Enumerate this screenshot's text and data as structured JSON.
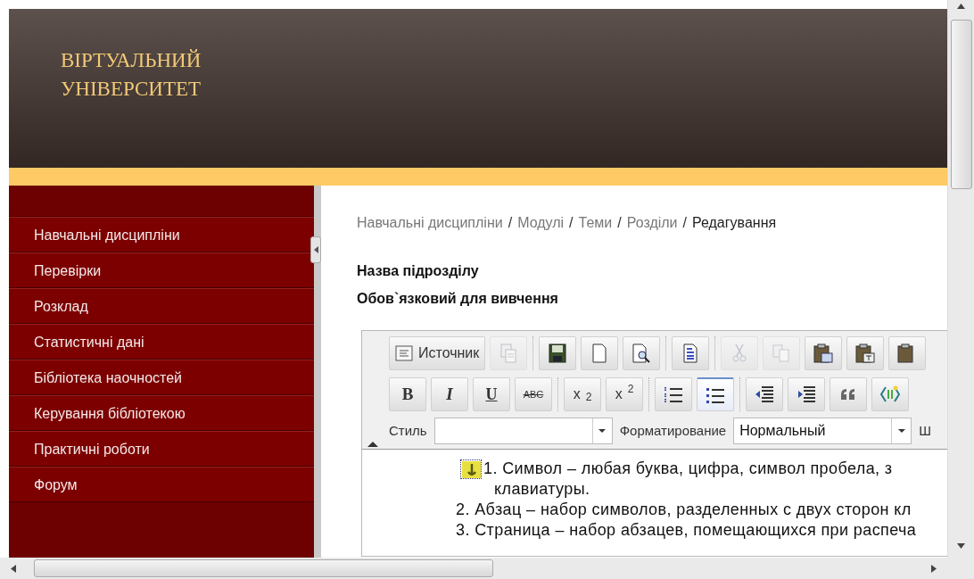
{
  "header": {
    "title_lines": [
      "ВІРТУАЛЬНИЙ",
      "УНІВЕРСИТЕТ"
    ]
  },
  "sidebar": {
    "items": [
      {
        "label": "Навчальні дисципліни"
      },
      {
        "label": "Перевірки"
      },
      {
        "label": "Розклад"
      },
      {
        "label": "Статистичні дані"
      },
      {
        "label": "Бібліотека наочностей"
      },
      {
        "label": "Керування бібліотекою"
      },
      {
        "label": "Практичні роботи"
      },
      {
        "label": "Форум"
      }
    ]
  },
  "breadcrumb": [
    {
      "label": "Навчальні дисципліни",
      "current": false,
      "separator": "/"
    },
    {
      "label": "Модулі",
      "current": false,
      "separator": "/"
    },
    {
      "label": "Теми",
      "current": false,
      "separator": "/"
    },
    {
      "label": "Розділи",
      "current": false,
      "separator": "/"
    },
    {
      "label": "Редагування",
      "current": true
    }
  ],
  "fields": [
    "Назва підрозділу",
    "Обов`язковий для вивчення"
  ],
  "editor": {
    "toolbar_rows": [
      [
        [
          {
            "kind": "source",
            "label": "Источник",
            "disabled": false,
            "active": false
          },
          {
            "kind": "paste-template",
            "disabled": true,
            "active": false
          }
        ],
        [
          {
            "kind": "save",
            "disabled": false,
            "active": false
          },
          {
            "kind": "new-page",
            "disabled": false,
            "active": false
          },
          {
            "kind": "preview",
            "disabled": false,
            "active": false
          }
        ],
        [
          {
            "kind": "templates",
            "disabled": false,
            "active": false
          }
        ],
        [
          {
            "kind": "cut",
            "disabled": true,
            "active": false
          },
          {
            "kind": "copy",
            "disabled": true,
            "active": false
          },
          {
            "kind": "paste",
            "disabled": false,
            "active": false
          },
          {
            "kind": "paste-text",
            "disabled": false,
            "active": false
          },
          {
            "kind": "paste-word",
            "disabled": false,
            "active": false
          }
        ]
      ],
      [
        [
          {
            "kind": "bold",
            "label": "B",
            "disabled": false,
            "active": false
          },
          {
            "kind": "italic",
            "label": "I",
            "disabled": false,
            "active": false
          },
          {
            "kind": "underline",
            "label": "U",
            "disabled": false,
            "active": false
          },
          {
            "kind": "strike",
            "label": "ABC",
            "disabled": false,
            "active": false
          }
        ],
        [
          {
            "kind": "subscript",
            "label": "x$_{2}$",
            "disabled": false,
            "active": false
          },
          {
            "kind": "superscript",
            "label": "x$^{2}$",
            "disabled": false,
            "active": false
          }
        ],
        [
          {
            "kind": "ordered-list",
            "disabled": false,
            "active": false
          },
          {
            "kind": "bulleted-list",
            "disabled": false,
            "active": true
          }
        ],
        [
          {
            "kind": "outdent",
            "disabled": false,
            "active": false
          },
          {
            "kind": "indent",
            "disabled": false,
            "active": false
          },
          {
            "kind": "quote",
            "disabled": false,
            "active": false
          },
          {
            "kind": "div",
            "disabled": false,
            "active": false
          }
        ]
      ]
    ],
    "combos": [
      {
        "label": "Стиль"
      },
      {
        "label": "Форматирование",
        "value": "Нормальный"
      }
    ],
    "cut_label": "Ш",
    "content": [
      {
        "lines": [
          "1. Символ – любая буква, цифра, символ пробела, з",
          "клавиатуры."
        ],
        "anchor": true
      },
      {
        "lines": [
          "2. Абзац – набор символов, разделенных с двух сторон кл"
        ],
        "anchor": false
      },
      {
        "lines": [
          "3. Страница – набор абзацев, помещающихся при распеча"
        ],
        "anchor": false
      }
    ]
  }
}
